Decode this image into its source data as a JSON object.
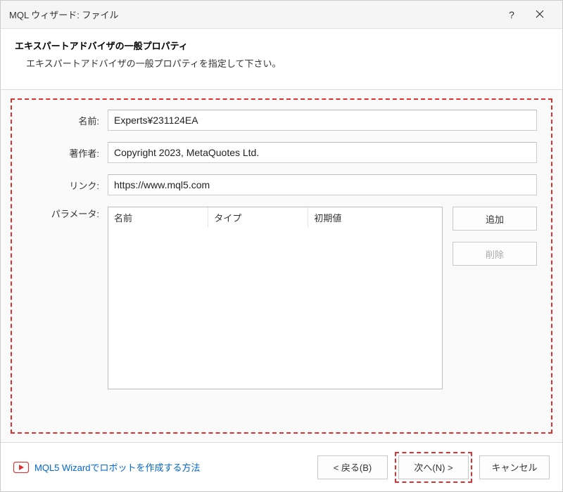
{
  "titlebar": {
    "title": "MQL ウィザード: ファイル",
    "help": "?",
    "close": "×"
  },
  "header": {
    "heading": "エキスパートアドバイザの一般プロパティ",
    "sub": "エキスパートアドバイザの一般プロパティを指定して下さい。"
  },
  "form": {
    "name_label": "名前:",
    "name_value": "Experts¥231124EA",
    "author_label": "著作者:",
    "author_value": "Copyright 2023, MetaQuotes Ltd.",
    "link_label": "リンク:",
    "link_value": "https://www.mql5.com",
    "params_label": "パラメータ:",
    "cols": {
      "c1": "名前",
      "c2": "タイプ",
      "c3": "初期値"
    },
    "add_label": "追加",
    "del_label": "削除"
  },
  "footer": {
    "link_text": "MQL5 Wizardでロボットを作成する方法",
    "back": "< 戻る(B)",
    "next": "次へ(N) >",
    "cancel": "キャンセル"
  }
}
